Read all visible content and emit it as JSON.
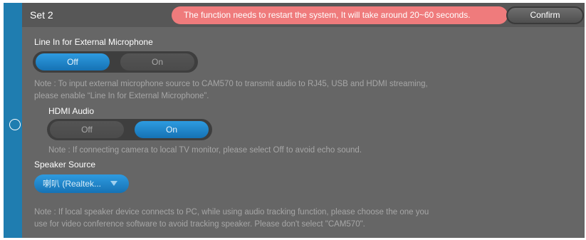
{
  "header": {
    "set_title": "Set 2",
    "restart_message": "The function needs to restart the system, It will take around 20~60 seconds.",
    "confirm_label": "Confirm"
  },
  "line_in": {
    "label": "Line In for External Microphone",
    "options": [
      "Off",
      "On"
    ],
    "selected": "Off",
    "note_line1": "Note : To input external microphone source to CAM570 to transmit audio to RJ45, USB and HDMI streaming,",
    "note_line2": "please enable “Line In for External Microphone”."
  },
  "hdmi_audio": {
    "label": "HDMI Audio",
    "options": [
      "Off",
      "On"
    ],
    "selected": "On",
    "note": "Note : If connecting camera to local TV monitor, please select Off to avoid echo sound."
  },
  "speaker_source": {
    "label": "Speaker Source",
    "selected_value": "喇叭 (Realtek...",
    "note_line1": "Note : If local speaker device connects to PC, while using audio tracking function, please choose the one you",
    "note_line2": "use for video conference software to avoid tracking speaker. Please don't select \"CAM570\"."
  },
  "colors": {
    "accent_blue": "#1f7db0",
    "banner_red": "#ef7b7c",
    "panel_gray": "#666666"
  }
}
